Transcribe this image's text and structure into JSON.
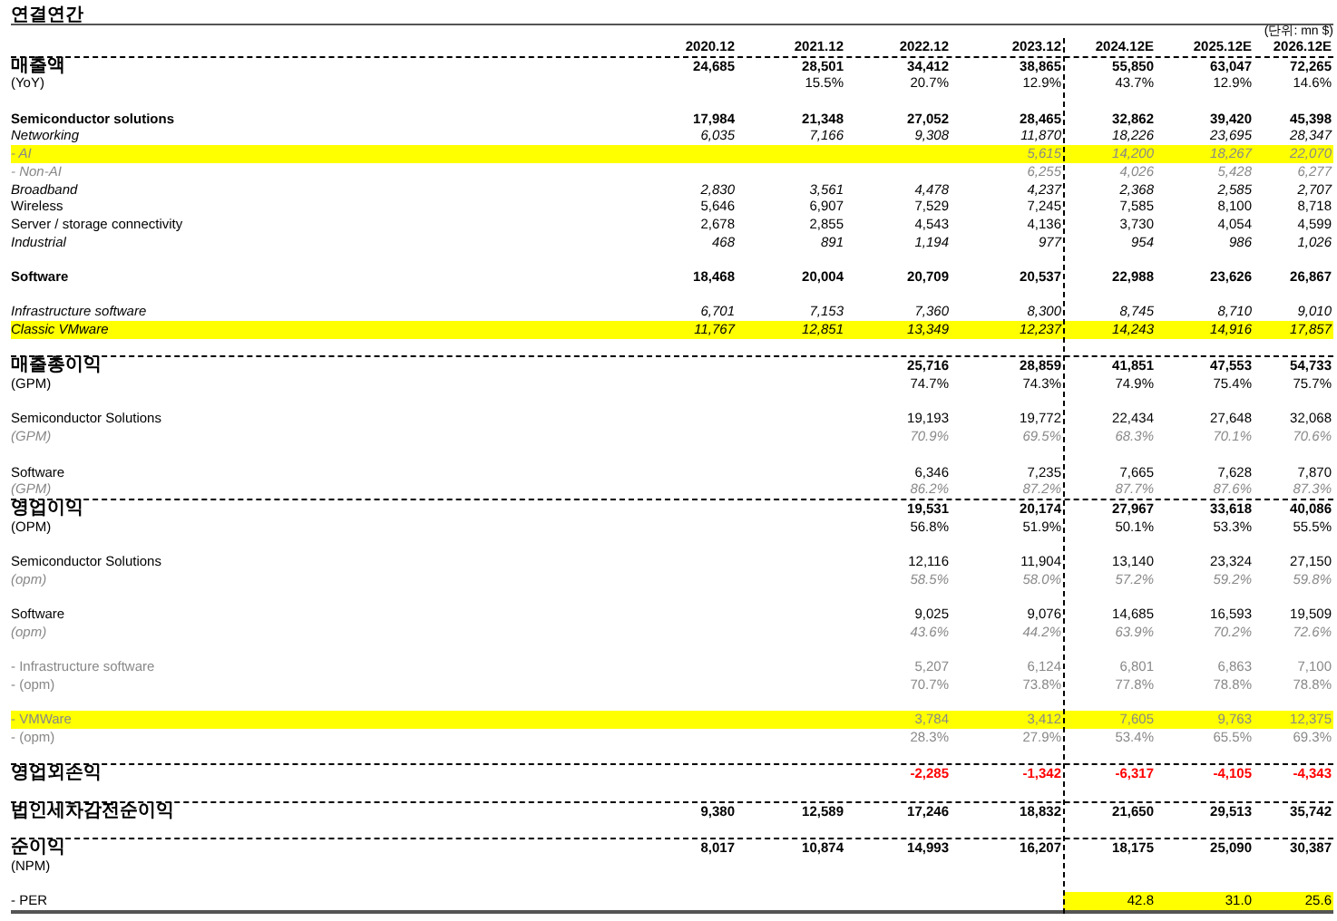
{
  "title": "연결연간",
  "unit": "(단위: mn $)",
  "columns": [
    {
      "label": "2020.12"
    },
    {
      "label": "2021.12"
    },
    {
      "label": "2022.12"
    },
    {
      "label": "2023.12"
    },
    {
      "label": "2024.12E",
      "divider_before": true
    },
    {
      "label": "2025.12E"
    },
    {
      "label": "2026.12E"
    }
  ],
  "rows": [
    {
      "label": "매출액",
      "kind": "total",
      "values": [
        "24,685",
        "28,501",
        "34,412",
        "38,865",
        "55,850",
        "63,047",
        "72,265"
      ]
    },
    {
      "label": "(YoY)",
      "kind": "ratio",
      "values": [
        "15.5%",
        "20.7%",
        "12.9%",
        "43.7%",
        "12.9%",
        "14.6%"
      ]
    },
    {
      "kind": "blank"
    },
    {
      "label": "Semiconductor solutions",
      "kind": "total",
      "values": [
        "17,984",
        "21,348",
        "27,052",
        "28,465",
        "32,862",
        "39,420",
        "45,398"
      ]
    },
    {
      "label": "Networking",
      "kind": "italic",
      "values": [
        "6,035",
        "7,166",
        "9,308",
        "11,870",
        "18,226",
        "23,695",
        "28,347"
      ]
    },
    {
      "label": "- AI",
      "kind": "muted-italic",
      "highlighted": true,
      "values": [
        "5,615",
        "14,200",
        "18,267",
        "22,070"
      ]
    },
    {
      "label": "- Non-AI",
      "kind": "muted-italic",
      "values": [
        "6,255",
        "4,026",
        "5,428",
        "6,277"
      ]
    },
    {
      "label": "Broadband",
      "kind": "italic",
      "values": [
        "2,830",
        "3,561",
        "4,478",
        "4,237",
        "2,368",
        "2,585",
        "2,707"
      ]
    },
    {
      "label": "Wireless",
      "kind": "item",
      "values": [
        "5,646",
        "6,907",
        "7,529",
        "7,245",
        "7,585",
        "8,100",
        "8,718"
      ]
    },
    {
      "label": "Server / storage connectivity",
      "kind": "item",
      "values": [
        "2,678",
        "2,855",
        "4,543",
        "4,136",
        "3,730",
        "4,054",
        "4,599"
      ]
    },
    {
      "label": "Industrial",
      "kind": "italic",
      "values": [
        "468",
        "891",
        "1,194",
        "977",
        "954",
        "986",
        "1,026"
      ]
    },
    {
      "kind": "blank"
    },
    {
      "label": "Software",
      "kind": "total",
      "values": [
        "18,468",
        "20,004",
        "20,709",
        "20,537",
        "22,988",
        "23,626",
        "26,867"
      ]
    },
    {
      "kind": "blank"
    },
    {
      "label": "Infrastructure software",
      "kind": "italic",
      "values": [
        "6,701",
        "7,153",
        "7,360",
        "8,300",
        "8,745",
        "8,710",
        "9,010"
      ]
    },
    {
      "label": "Classic VMware",
      "kind": "italic",
      "highlighted": true,
      "values": [
        "11,767",
        "12,851",
        "13,349",
        "12,237",
        "14,243",
        "14,916",
        "17,857"
      ]
    },
    {
      "kind": "blank"
    },
    {
      "label": "매출총이익",
      "kind": "total",
      "rule_above": true,
      "values": [
        "25,716",
        "28,859",
        "41,851",
        "47,553",
        "54,733"
      ]
    },
    {
      "label": "(GPM)",
      "kind": "ratio",
      "values": [
        "74.7%",
        "74.3%",
        "74.9%",
        "75.4%",
        "75.7%"
      ]
    },
    {
      "kind": "blank"
    },
    {
      "label": "Semiconductor Solutions",
      "kind": "item",
      "values": [
        "19,193",
        "19,772",
        "22,434",
        "27,648",
        "32,068"
      ]
    },
    {
      "label": "(GPM)",
      "kind": "muted-italic",
      "values": [
        "70.9%",
        "69.5%",
        "68.3%",
        "70.1%",
        "70.6%"
      ]
    },
    {
      "kind": "blank"
    },
    {
      "label": "Software",
      "kind": "item",
      "values": [
        "6,346",
        "7,235",
        "7,665",
        "7,628",
        "7,870"
      ]
    },
    {
      "label": "(GPM)",
      "kind": "muted-italic",
      "values": [
        "86.2%",
        "87.2%",
        "87.7%",
        "87.6%",
        "87.3%"
      ]
    },
    {
      "label": "영업이익",
      "kind": "total",
      "rule_above": true,
      "values": [
        "19,531",
        "20,174",
        "27,967",
        "33,618",
        "40,086"
      ]
    },
    {
      "label": "(OPM)",
      "kind": "ratio",
      "values": [
        "56.8%",
        "51.9%",
        "50.1%",
        "53.3%",
        "55.5%"
      ]
    },
    {
      "kind": "blank"
    },
    {
      "label": "Semiconductor Solutions",
      "kind": "item",
      "values": [
        "12,116",
        "11,904",
        "13,140",
        "23,324",
        "27,150"
      ]
    },
    {
      "label": "(opm)",
      "kind": "muted-italic",
      "values": [
        "58.5%",
        "58.0%",
        "57.2%",
        "59.2%",
        "59.8%"
      ]
    },
    {
      "kind": "blank"
    },
    {
      "label": "Software",
      "kind": "item",
      "values": [
        "9,025",
        "9,076",
        "14,685",
        "16,593",
        "19,509"
      ]
    },
    {
      "label": "(opm)",
      "kind": "muted-italic",
      "values": [
        "43.6%",
        "44.2%",
        "63.9%",
        "70.2%",
        "72.6%"
      ]
    },
    {
      "kind": "blank"
    },
    {
      "label": "- Infrastructure software",
      "kind": "muted",
      "values": [
        "5,207",
        "6,124",
        "6,801",
        "6,863",
        "7,100"
      ]
    },
    {
      "label": "- (opm)",
      "kind": "muted",
      "values": [
        "70.7%",
        "73.8%",
        "77.8%",
        "78.8%",
        "78.8%"
      ]
    },
    {
      "kind": "blank"
    },
    {
      "label": "- VMWare",
      "kind": "muted",
      "highlighted": true,
      "values": [
        "3,784",
        "3,412",
        "7,605",
        "9,763",
        "12,375"
      ]
    },
    {
      "label": "- (opm)",
      "kind": "muted",
      "values": [
        "28.3%",
        "27.9%",
        "53.4%",
        "65.5%",
        "69.3%"
      ]
    },
    {
      "kind": "blank"
    },
    {
      "label": "영업외손익",
      "kind": "loss",
      "rule_above": true,
      "values": [
        "-2,285",
        "-1,342",
        "-6,317",
        "-4,105",
        "-4,343"
      ]
    },
    {
      "kind": "blank"
    },
    {
      "label": "법인세차감전순이익",
      "kind": "total",
      "rule_above": true,
      "values": [
        "9,380",
        "12,589",
        "17,246",
        "18,832",
        "21,650",
        "29,513",
        "35,742"
      ]
    },
    {
      "kind": "blank"
    },
    {
      "label": "순이익",
      "kind": "total",
      "rule_above": true,
      "values": [
        "8,017",
        "10,874",
        "14,993",
        "16,207",
        "18,175",
        "25,090",
        "30,387"
      ]
    },
    {
      "label": "(NPM)",
      "kind": "ratio"
    },
    {
      "kind": "blank"
    },
    {
      "label": "- PER",
      "kind": "multiple",
      "highlighted": true,
      "values": [
        "42.8",
        "31.0",
        "25.6"
      ]
    }
  ]
}
